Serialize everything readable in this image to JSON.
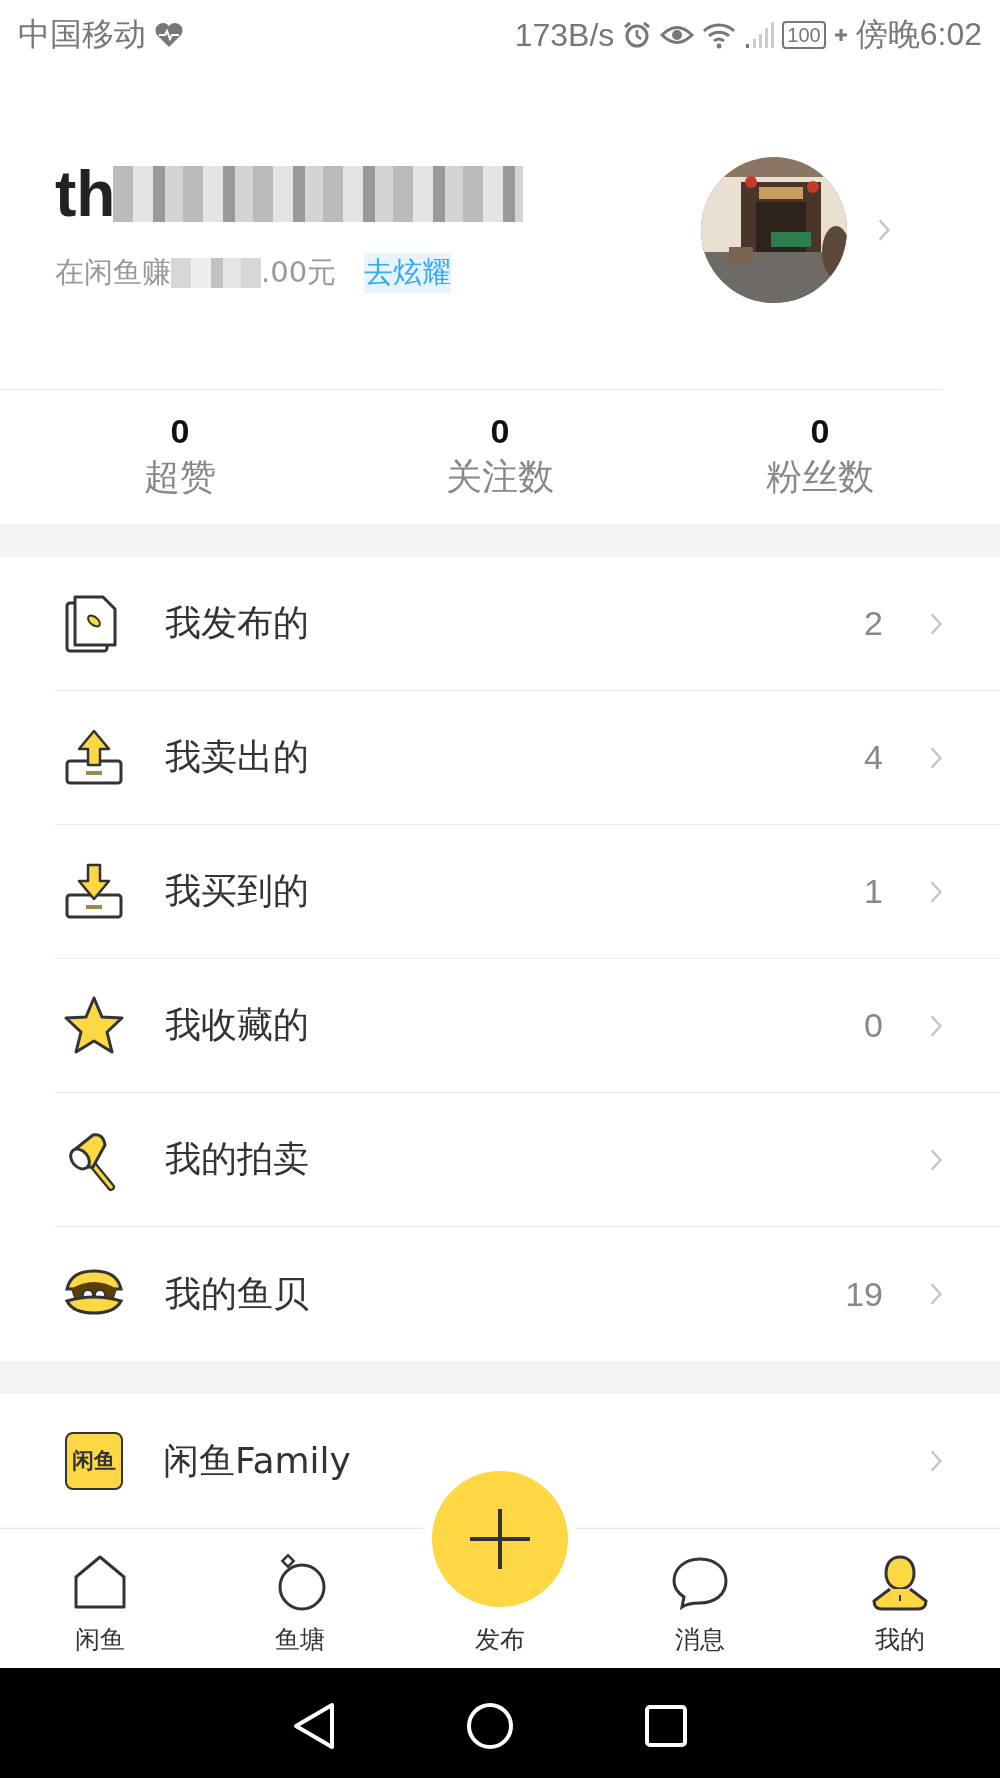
{
  "status_bar": {
    "carrier": "中国移动",
    "speed": "173B/s",
    "battery": "100",
    "time": "傍晚6:02"
  },
  "profile": {
    "username": "th",
    "earnings_prefix": "在闲鱼赚",
    "earnings_suffix": ".00元",
    "show_off_link": "去炫耀"
  },
  "stats": [
    {
      "value": "0",
      "label": "超赞"
    },
    {
      "value": "0",
      "label": "关注数"
    },
    {
      "value": "0",
      "label": "粉丝数"
    }
  ],
  "menu": [
    {
      "kind": "document",
      "label": "我发布的",
      "count": "2"
    },
    {
      "kind": "upload",
      "label": "我卖出的",
      "count": "4"
    },
    {
      "kind": "download",
      "label": "我买到的",
      "count": "1"
    },
    {
      "kind": "star",
      "label": "我收藏的",
      "count": "0"
    },
    {
      "kind": "hammer",
      "label": "我的拍卖"
    },
    {
      "kind": "clam",
      "label": "我的鱼贝",
      "count": "19"
    }
  ],
  "family": {
    "logo_text": "闲鱼",
    "label": "闲鱼Family"
  },
  "tab_bar": [
    {
      "kind": "home",
      "label": "闲鱼",
      "selected": false
    },
    {
      "kind": "pond",
      "label": "鱼塘",
      "selected": false
    },
    {
      "kind": "plus",
      "label": "发布",
      "selected": false
    },
    {
      "kind": "chat",
      "label": "消息",
      "selected": false
    },
    {
      "kind": "person",
      "label": "我的",
      "selected": true
    }
  ]
}
